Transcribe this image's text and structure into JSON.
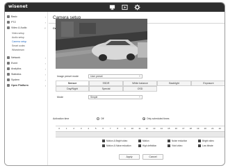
{
  "app": {
    "logo": "wisenet"
  },
  "topbar": {
    "icons": [
      "monitor-icon",
      "playback-icon",
      "settings-gear-icon"
    ]
  },
  "sidebar": {
    "items": [
      {
        "label": "Basic",
        "icon": "basic-icon"
      },
      {
        "label": "PTZ",
        "icon": "ptz-icon"
      },
      {
        "label": "Video & Audio",
        "icon": "video-audio-icon"
      },
      {
        "label": "Network",
        "icon": "network-icon"
      },
      {
        "label": "Event",
        "icon": "event-icon"
      },
      {
        "label": "Analytics",
        "icon": "analytics-icon"
      },
      {
        "label": "Statistics",
        "icon": "statistics-icon"
      },
      {
        "label": "System",
        "icon": "system-icon"
      },
      {
        "label": "Open Platform",
        "icon": "open-platform-icon"
      }
    ],
    "subitems": [
      "Video setup",
      "Audio setup",
      "Camera setup",
      "Smart codec",
      "Wisestream"
    ]
  },
  "main": {
    "title": "Camera setup",
    "section": "Camera setup",
    "preset_label": "Image preset mode",
    "preset_value": "User preset",
    "tabs_row1": [
      "Sensor",
      "SSDR",
      "White balance",
      "Backlight",
      "Exposure"
    ],
    "tabs_row2": [
      "Day/Night",
      "Special",
      "OSD"
    ],
    "mode_label": "Mode",
    "mode_value": "Simple",
    "activation_label": "Activation time",
    "activation_off": "Off",
    "activation_schedule": "Only scheduled times",
    "hours": [
      "0",
      "1",
      "2",
      "3",
      "4",
      "5",
      "6",
      "7",
      "8",
      "9",
      "10",
      "11",
      "12",
      "13",
      "14",
      "15",
      "16",
      "17",
      "18",
      "19",
      "20",
      "21",
      "22",
      "23"
    ],
    "legend": [
      "Motion & Bright video",
      "Motion",
      "Noise reduction",
      "Bright video",
      "Motion & Noise reduction",
      "High definition",
      "Vivid video",
      "Low bitrate"
    ],
    "apply_label": "Apply",
    "cancel_label": "Cancel"
  }
}
